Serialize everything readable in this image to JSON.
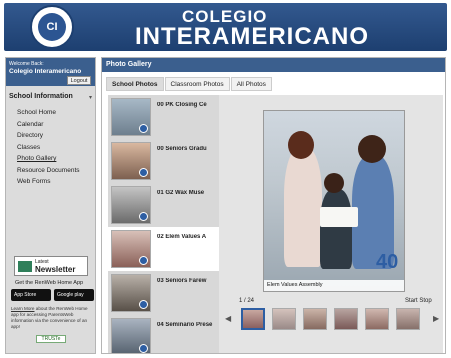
{
  "header": {
    "seal_text": "CI",
    "line1": "COLEGIO",
    "line2": "INTERAMERICANO"
  },
  "sidebar": {
    "welcome_label": "Welcome Back:",
    "school_name": "Colegio Interamericano",
    "logout_label": "Logout",
    "section_title": "School Information",
    "items": [
      "School Home",
      "Calendar",
      "Directory",
      "Classes",
      "Photo Gallery",
      "Resource Documents",
      "Web Forms"
    ],
    "newsletter_top": "Latest",
    "newsletter_main": "Newsletter",
    "app_text": "Get the RenWeb Home App",
    "appstore_label": "App Store",
    "googleplay_label": "Google play",
    "learn_link": "Learn More",
    "learn_text": " about the RenWeb Home app for accessing ParentsWeb information via the convenience of an app!",
    "truste_label": "TRUSTe"
  },
  "gallery": {
    "title": "Photo Gallery",
    "tabs": [
      "School Photos",
      "Classroom Photos",
      "All Photos"
    ],
    "items": [
      {
        "label": "00 PK Closing Ce"
      },
      {
        "label": "00 Seniors Gradu"
      },
      {
        "label": "01 G2 Wax Muse"
      },
      {
        "label": "02 Elem Values A"
      },
      {
        "label": "03 Seniors Farew"
      },
      {
        "label": "04 Seminario Prese"
      }
    ],
    "caption": "Elem Values Assembly",
    "badge_text": "40",
    "counter": "1 / 24",
    "start_label": "Start",
    "stop_label": "Stop"
  },
  "colors": {
    "header_blue": "#1d3f70",
    "panel_blue": "#3b5f8e",
    "badge_blue": "#2d5ea3"
  }
}
